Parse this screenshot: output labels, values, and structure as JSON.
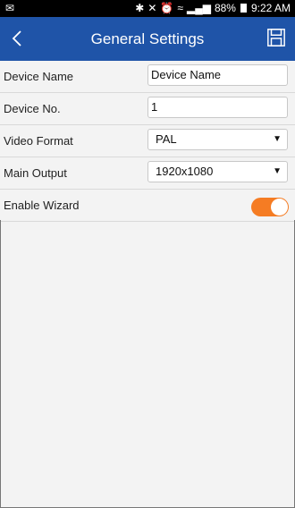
{
  "status": {
    "left_icon": "notification-icon",
    "bluetooth": "bluetooth-icon",
    "mute": "mute-icon",
    "alarm": "alarm-icon",
    "wifi": "wifi-icon",
    "signal": "signal-icon",
    "battery_percent": "88%",
    "time": "9:22 AM"
  },
  "header": {
    "title": "General Settings",
    "back_icon": "back-chevron-icon",
    "save_icon": "save-icon"
  },
  "settings": {
    "device_name_label": "Device Name",
    "device_name_value": "Device Name",
    "device_no_label": "Device No.",
    "device_no_value": "1",
    "video_format_label": "Video Format",
    "video_format_value": "PAL",
    "main_output_label": "Main Output",
    "main_output_value": "1920x1080",
    "enable_wizard_label": "Enable Wizard",
    "enable_wizard_on": true
  },
  "colors": {
    "header_bg": "#1f54a8",
    "toggle_on": "#f57c23",
    "page_bg": "#f3f3f3"
  }
}
